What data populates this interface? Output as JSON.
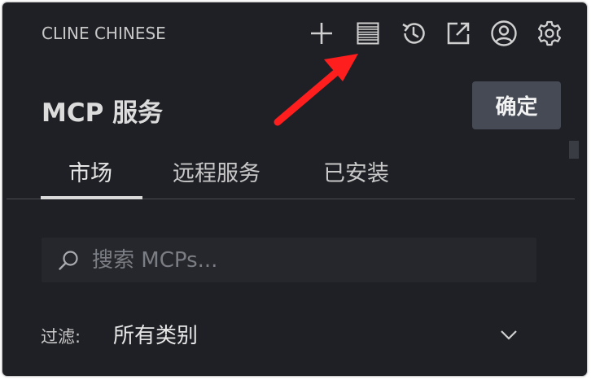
{
  "header": {
    "app_title": "CLINE CHINESE",
    "icons": [
      {
        "name": "plus-icon"
      },
      {
        "name": "mcp-servers-icon"
      },
      {
        "name": "history-icon"
      },
      {
        "name": "external-link-icon"
      },
      {
        "name": "account-icon"
      },
      {
        "name": "settings-icon"
      }
    ]
  },
  "page": {
    "title": "MCP 服务",
    "confirm_label": "确定"
  },
  "tabs": [
    {
      "label": "市场",
      "active": true
    },
    {
      "label": "远程服务",
      "active": false
    },
    {
      "label": "已安装",
      "active": false
    }
  ],
  "search": {
    "placeholder": "搜索 MCPs...",
    "value": ""
  },
  "filter": {
    "label": "过滤:",
    "selected": "所有类别"
  },
  "colors": {
    "background": "#1f2025",
    "button": "#454a55",
    "search_bg": "#26272c",
    "annotation_arrow": "#ff1e1e"
  }
}
